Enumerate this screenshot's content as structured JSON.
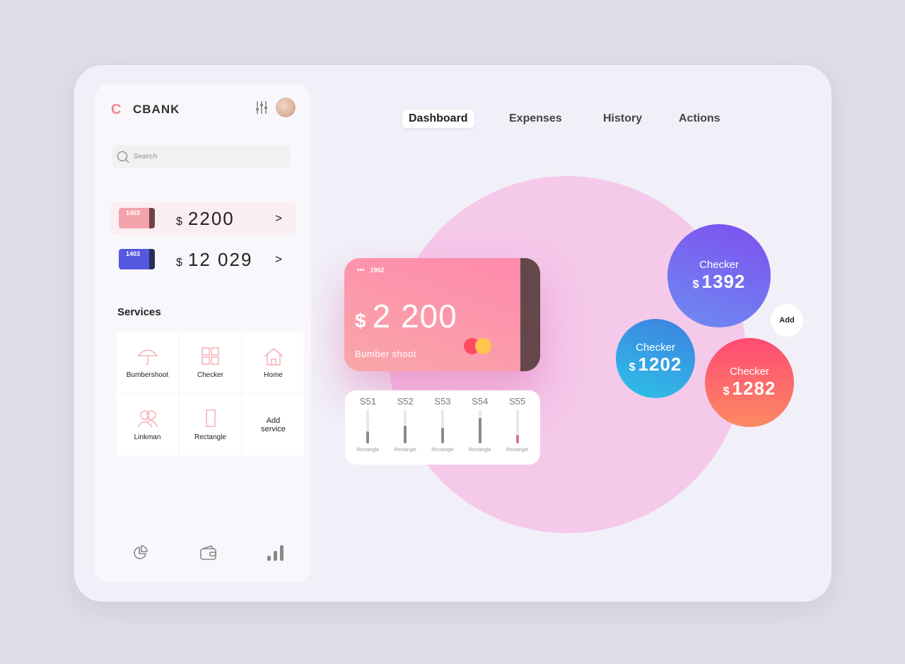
{
  "sidebar": {
    "logo": "C",
    "brand": "CBANK",
    "search_placeholder": "Search",
    "accounts": [
      {
        "chip": "1403",
        "currency": "$",
        "amount": "2200",
        "arrow": ">",
        "color": "#f4a3aa"
      },
      {
        "chip": "1403",
        "currency": "$",
        "amount": "12 029",
        "arrow": ">",
        "color": "#5457e0"
      }
    ],
    "services_title": "Services",
    "services": [
      {
        "label": "Bumbershoot",
        "icon": "umbrella-icon"
      },
      {
        "label": "Checker",
        "icon": "grid-icon"
      },
      {
        "label": "Home",
        "icon": "home-icon"
      },
      {
        "label": "Linkman",
        "icon": "users-icon"
      },
      {
        "label": "Rectangle",
        "icon": "rectangle-icon"
      },
      {
        "label": "Add service",
        "icon": ""
      }
    ],
    "bottom_icons": [
      "pie-chart-icon",
      "wallet-icon",
      "signal-bars-icon"
    ]
  },
  "nav": {
    "tabs": [
      {
        "label": "Dashboard",
        "active": true
      },
      {
        "label": "Expenses"
      },
      {
        "label": "History"
      },
      {
        "label": "Actions"
      }
    ]
  },
  "card": {
    "dots": "•••",
    "number": "1902",
    "currency": "$",
    "amount": "2 200",
    "name": "Bumber shoot"
  },
  "stats": [
    {
      "label": "S51",
      "sub": "Rectangle",
      "level": 0.35
    },
    {
      "label": "S52",
      "sub": "Rectangle",
      "level": 0.52
    },
    {
      "label": "S53",
      "sub": "Rectangle",
      "level": 0.45
    },
    {
      "label": "S54",
      "sub": "Rectangle",
      "level": 0.75
    },
    {
      "label": "S55",
      "sub": "Rectangle",
      "level": 0.25,
      "color": "#e06aaa"
    }
  ],
  "bubbles": [
    {
      "title": "Checker",
      "currency": "$",
      "amount": "1392"
    },
    {
      "title": "Checker",
      "currency": "$",
      "amount": "1202"
    },
    {
      "title": "Checker",
      "currency": "$",
      "amount": "1282"
    }
  ],
  "add_label": "Add"
}
